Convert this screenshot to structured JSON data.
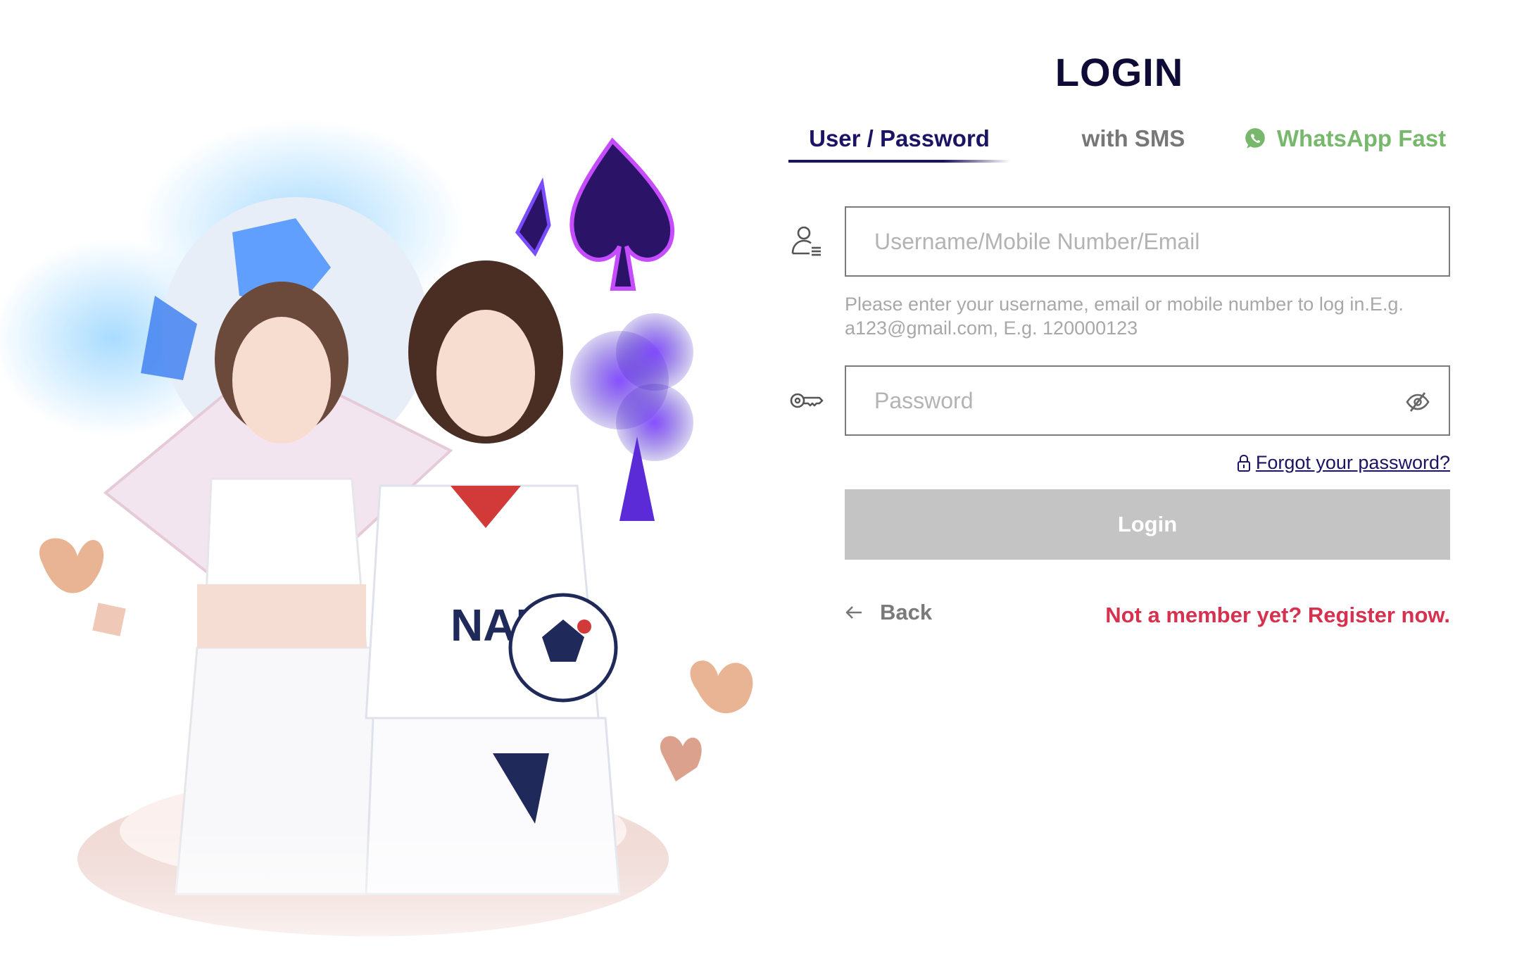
{
  "page": {
    "title": "LOGIN"
  },
  "tabs": [
    {
      "label": "User / Password",
      "active": true
    },
    {
      "label": "with SMS",
      "active": false
    },
    {
      "label": "WhatsApp Fast",
      "active": false,
      "icon": "whatsapp-icon"
    }
  ],
  "form": {
    "username": {
      "placeholder": "Username/Mobile Number/Email",
      "value": "",
      "icon": "user-list-icon",
      "hint": "Please enter your username, email or mobile number to log in.E.g. a123@gmail.com, E.g. 120000123"
    },
    "password": {
      "placeholder": "Password",
      "value": "",
      "icon": "key-icon",
      "toggle_icon": "eye-slash-icon"
    },
    "forgot_label": "Forgot your password?",
    "login_label": "Login"
  },
  "footer": {
    "back_label": "Back",
    "register_label": "Not a member yet? Register now."
  },
  "colors": {
    "title": "#0e0b36",
    "tab_active": "#1b1464",
    "tab_inactive": "#777777",
    "whatsapp": "#77b86d",
    "button_disabled": "#c4c4c4",
    "register": "#d6314f",
    "hint": "#a8a8a8"
  }
}
